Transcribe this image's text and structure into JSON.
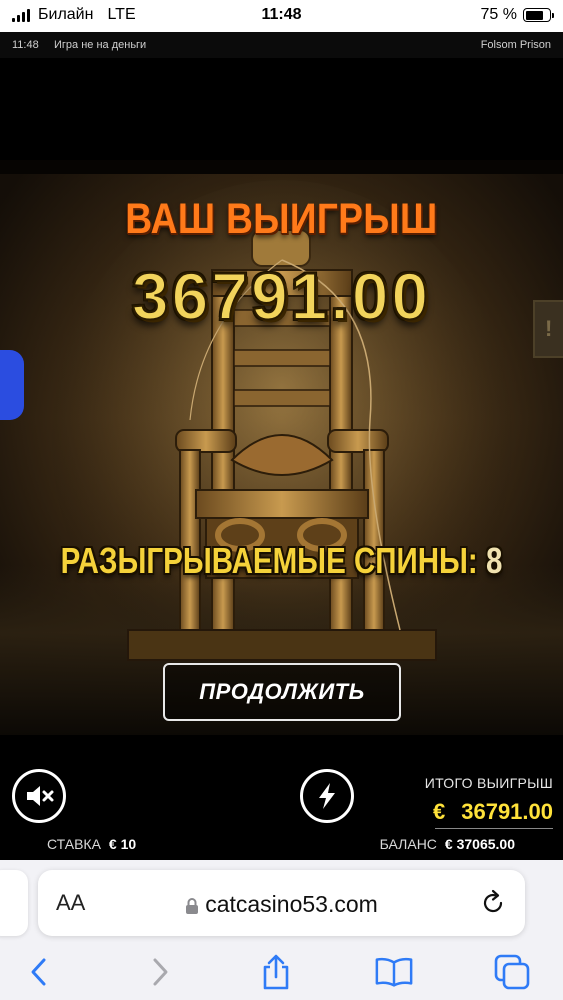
{
  "status_bar": {
    "carrier": "Билайн",
    "network": "LTE",
    "time": "11:48",
    "battery": "75 %",
    "battery_level_percent": 75
  },
  "game_info": {
    "time": "11:48",
    "mode": "Игра не на деньги",
    "game_name": "Folsom Prison"
  },
  "win_popup": {
    "title": "ВАШ ВЫИГРЫШ",
    "amount": "36791.00",
    "spins_label": "РАЗЫГРЫВАЕМЫЕ СПИНЫ:",
    "spins_value": "8",
    "continue_label": "ПРОДОЛЖИТЬ"
  },
  "game_bar": {
    "total_win_label": "ИТОГО ВЫИГРЫШ",
    "currency": "€",
    "total_win_value": "36791.00",
    "stake_label": "СТАВКА",
    "stake_value": "€  10",
    "balance_label": "БАЛАНС",
    "balance_value": "€  37065.00"
  },
  "browser": {
    "aa_label": "AA",
    "host": "catcasino53.com"
  },
  "colors": {
    "title_orange": "#ff7a1a",
    "amount_gold": "#f2d45c",
    "total_yellow": "#ffe23a",
    "ios_blue": "#2f7bf6"
  },
  "icons": {
    "mute": "speaker-muted-icon",
    "turbo": "lightning-bolt-icon",
    "back": "chevron-left-icon",
    "forward": "chevron-right-icon",
    "share": "share-icon",
    "bookmarks": "book-icon",
    "tabs": "tabs-icon",
    "reload": "reload-icon",
    "lock": "lock-icon"
  }
}
